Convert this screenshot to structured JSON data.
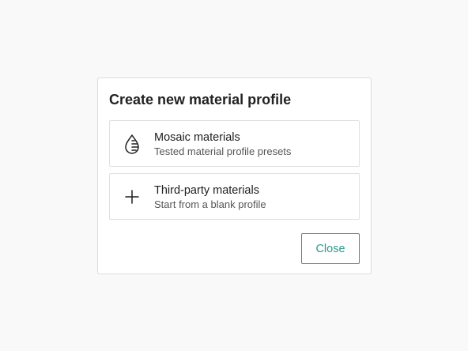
{
  "dialog": {
    "title": "Create new material profile",
    "options": [
      {
        "icon": "material-drop-icon",
        "label": "Mosaic materials",
        "description": "Tested material profile presets"
      },
      {
        "icon": "plus-icon",
        "label": "Third-party materials",
        "description": "Start from a blank profile"
      }
    ],
    "close_label": "Close"
  },
  "colors": {
    "accent": "#2a9a8f",
    "background": "#f9f9f9",
    "dialog_background": "#ffffff",
    "border": "#dcdcdc"
  }
}
